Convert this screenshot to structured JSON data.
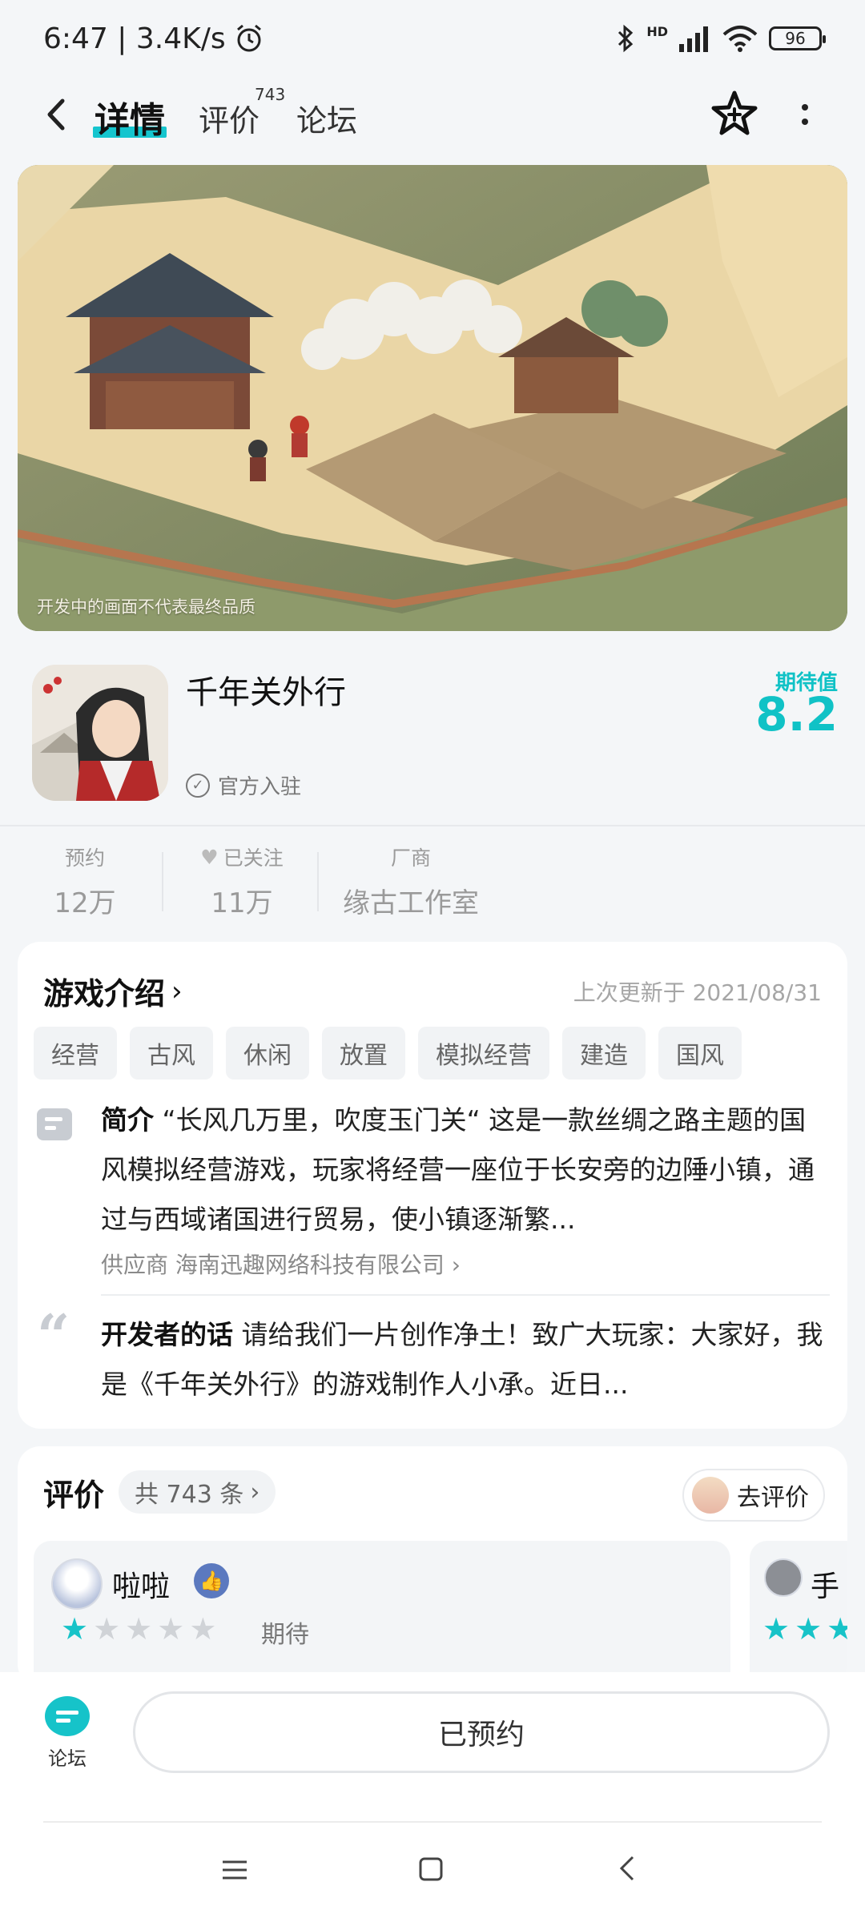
{
  "status_bar": {
    "time_speed": "6:47 | 3.4K/s",
    "alarm_icon": "alarm-icon",
    "bluetooth_icon": "bluetooth-icon",
    "signal_label": "HD",
    "battery": "96"
  },
  "nav": {
    "active_tab": "详情",
    "tab_reviews": "评价",
    "reviews_count": "743",
    "tab_forum": "论坛"
  },
  "banner": {
    "caption": "开发中的画面不代表最终品质"
  },
  "game": {
    "title": "千年关外行",
    "official_label": "官方入驻",
    "expect_label": "期待值",
    "expect_value": "8.2"
  },
  "stats": [
    {
      "label": "预约",
      "value": "12万"
    },
    {
      "label": "已关注",
      "value": "11万"
    },
    {
      "label": "厂商",
      "value": "缘古工作室"
    }
  ],
  "intro": {
    "title": "游戏介绍",
    "updated": "上次更新于 2021/08/31",
    "tags": [
      "经营",
      "古风",
      "休闲",
      "放置",
      "模拟经营",
      "建造",
      "国风"
    ],
    "summary_label": "简介",
    "summary": "“长风几万里，吹度玉门关“ 这是一款丝绸之路主题的国风模拟经营游戏，玩家将经营一座位于长安旁的边陲小镇，通过与西域诸国进行贸易，使小镇逐渐繁...",
    "supplier": "供应商 海南迅趣网络科技有限公司 ›",
    "dev_label": "开发者的话",
    "dev_text": "请给我们一片创作净土！致广大玩家：大家好，我是《千年关外行》的游戏制作人小承。近日..."
  },
  "reviews": {
    "title": "评价",
    "count": "共 743 条",
    "go_review": "去评价",
    "items": [
      {
        "name": "啦啦",
        "rating": 1,
        "max": 5,
        "status": "期待"
      },
      {
        "name": "手"
      }
    ]
  },
  "bottom": {
    "forum_label": "论坛",
    "reserved_label": "已预约"
  }
}
